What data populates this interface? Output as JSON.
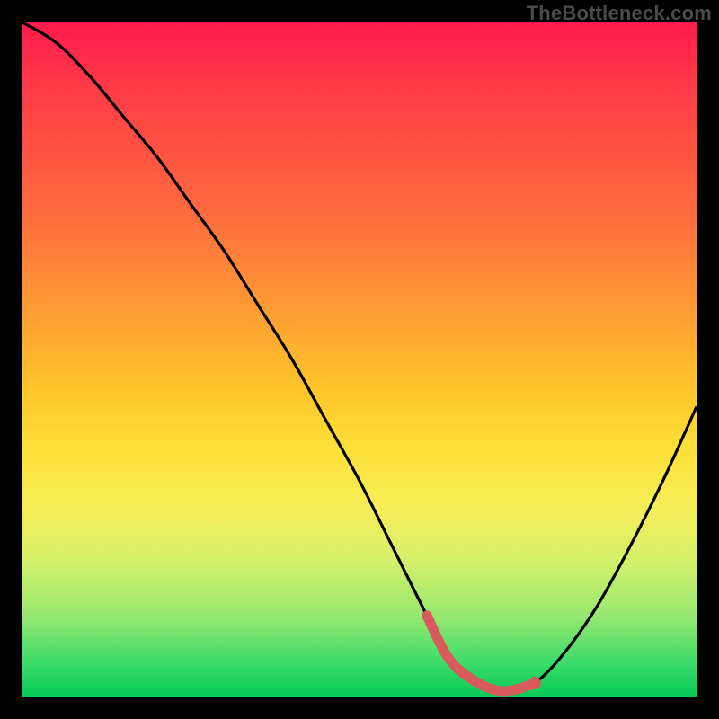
{
  "watermark": "TheBottleneck.com",
  "colors": {
    "frame": "#000000",
    "curve": "#000000",
    "marker_stroke": "#d85a5a",
    "marker_fill": "#d85a5a",
    "gradient_top": "#ff1a4b",
    "gradient_mid": "#ffe13a",
    "gradient_bottom": "#06c957"
  },
  "chart_data": {
    "type": "line",
    "title": "",
    "xlabel": "",
    "ylabel": "",
    "xlim": [
      0,
      100
    ],
    "ylim": [
      0,
      100
    ],
    "grid": false,
    "legend": false,
    "series": [
      {
        "name": "bottleneck-curve",
        "x": [
          0,
          5,
          10,
          15,
          20,
          25,
          30,
          35,
          40,
          45,
          50,
          55,
          60,
          63,
          66,
          70,
          73,
          76,
          80,
          85,
          90,
          95,
          100
        ],
        "values": [
          100,
          97,
          92,
          86,
          80,
          73,
          66,
          58,
          50,
          41,
          32,
          22,
          12,
          6,
          3,
          1,
          1,
          2,
          6,
          13,
          22,
          32,
          43
        ]
      }
    ],
    "highlight_segment": {
      "note": "thick reddish stroke on the flat bottom section + one right-side marker dot",
      "x": [
        60,
        63,
        66,
        70,
        73,
        76
      ],
      "values": [
        12,
        6,
        3,
        1,
        1,
        2
      ],
      "marker_point": {
        "x": 76,
        "y": 2
      }
    }
  }
}
